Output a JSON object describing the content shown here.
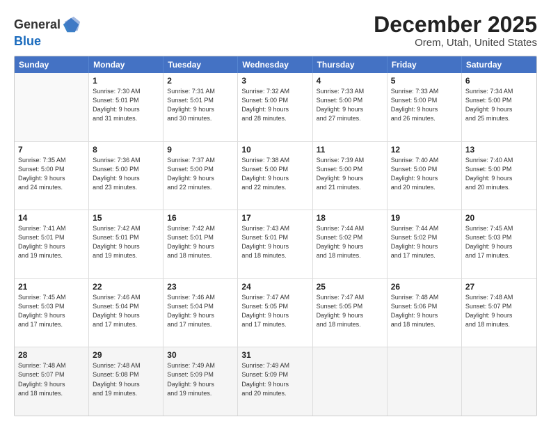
{
  "logo": {
    "line1": "General",
    "line2": "Blue"
  },
  "title": "December 2025",
  "subtitle": "Orem, Utah, United States",
  "days_header": [
    "Sunday",
    "Monday",
    "Tuesday",
    "Wednesday",
    "Thursday",
    "Friday",
    "Saturday"
  ],
  "weeks": [
    [
      {
        "day": "",
        "info": ""
      },
      {
        "day": "1",
        "info": "Sunrise: 7:30 AM\nSunset: 5:01 PM\nDaylight: 9 hours\nand 31 minutes."
      },
      {
        "day": "2",
        "info": "Sunrise: 7:31 AM\nSunset: 5:01 PM\nDaylight: 9 hours\nand 30 minutes."
      },
      {
        "day": "3",
        "info": "Sunrise: 7:32 AM\nSunset: 5:00 PM\nDaylight: 9 hours\nand 28 minutes."
      },
      {
        "day": "4",
        "info": "Sunrise: 7:33 AM\nSunset: 5:00 PM\nDaylight: 9 hours\nand 27 minutes."
      },
      {
        "day": "5",
        "info": "Sunrise: 7:33 AM\nSunset: 5:00 PM\nDaylight: 9 hours\nand 26 minutes."
      },
      {
        "day": "6",
        "info": "Sunrise: 7:34 AM\nSunset: 5:00 PM\nDaylight: 9 hours\nand 25 minutes."
      }
    ],
    [
      {
        "day": "7",
        "info": "Sunrise: 7:35 AM\nSunset: 5:00 PM\nDaylight: 9 hours\nand 24 minutes."
      },
      {
        "day": "8",
        "info": "Sunrise: 7:36 AM\nSunset: 5:00 PM\nDaylight: 9 hours\nand 23 minutes."
      },
      {
        "day": "9",
        "info": "Sunrise: 7:37 AM\nSunset: 5:00 PM\nDaylight: 9 hours\nand 22 minutes."
      },
      {
        "day": "10",
        "info": "Sunrise: 7:38 AM\nSunset: 5:00 PM\nDaylight: 9 hours\nand 22 minutes."
      },
      {
        "day": "11",
        "info": "Sunrise: 7:39 AM\nSunset: 5:00 PM\nDaylight: 9 hours\nand 21 minutes."
      },
      {
        "day": "12",
        "info": "Sunrise: 7:40 AM\nSunset: 5:00 PM\nDaylight: 9 hours\nand 20 minutes."
      },
      {
        "day": "13",
        "info": "Sunrise: 7:40 AM\nSunset: 5:00 PM\nDaylight: 9 hours\nand 20 minutes."
      }
    ],
    [
      {
        "day": "14",
        "info": "Sunrise: 7:41 AM\nSunset: 5:01 PM\nDaylight: 9 hours\nand 19 minutes."
      },
      {
        "day": "15",
        "info": "Sunrise: 7:42 AM\nSunset: 5:01 PM\nDaylight: 9 hours\nand 19 minutes."
      },
      {
        "day": "16",
        "info": "Sunrise: 7:42 AM\nSunset: 5:01 PM\nDaylight: 9 hours\nand 18 minutes."
      },
      {
        "day": "17",
        "info": "Sunrise: 7:43 AM\nSunset: 5:01 PM\nDaylight: 9 hours\nand 18 minutes."
      },
      {
        "day": "18",
        "info": "Sunrise: 7:44 AM\nSunset: 5:02 PM\nDaylight: 9 hours\nand 18 minutes."
      },
      {
        "day": "19",
        "info": "Sunrise: 7:44 AM\nSunset: 5:02 PM\nDaylight: 9 hours\nand 17 minutes."
      },
      {
        "day": "20",
        "info": "Sunrise: 7:45 AM\nSunset: 5:03 PM\nDaylight: 9 hours\nand 17 minutes."
      }
    ],
    [
      {
        "day": "21",
        "info": "Sunrise: 7:45 AM\nSunset: 5:03 PM\nDaylight: 9 hours\nand 17 minutes."
      },
      {
        "day": "22",
        "info": "Sunrise: 7:46 AM\nSunset: 5:04 PM\nDaylight: 9 hours\nand 17 minutes."
      },
      {
        "day": "23",
        "info": "Sunrise: 7:46 AM\nSunset: 5:04 PM\nDaylight: 9 hours\nand 17 minutes."
      },
      {
        "day": "24",
        "info": "Sunrise: 7:47 AM\nSunset: 5:05 PM\nDaylight: 9 hours\nand 17 minutes."
      },
      {
        "day": "25",
        "info": "Sunrise: 7:47 AM\nSunset: 5:05 PM\nDaylight: 9 hours\nand 18 minutes."
      },
      {
        "day": "26",
        "info": "Sunrise: 7:48 AM\nSunset: 5:06 PM\nDaylight: 9 hours\nand 18 minutes."
      },
      {
        "day": "27",
        "info": "Sunrise: 7:48 AM\nSunset: 5:07 PM\nDaylight: 9 hours\nand 18 minutes."
      }
    ],
    [
      {
        "day": "28",
        "info": "Sunrise: 7:48 AM\nSunset: 5:07 PM\nDaylight: 9 hours\nand 18 minutes."
      },
      {
        "day": "29",
        "info": "Sunrise: 7:48 AM\nSunset: 5:08 PM\nDaylight: 9 hours\nand 19 minutes."
      },
      {
        "day": "30",
        "info": "Sunrise: 7:49 AM\nSunset: 5:09 PM\nDaylight: 9 hours\nand 19 minutes."
      },
      {
        "day": "31",
        "info": "Sunrise: 7:49 AM\nSunset: 5:09 PM\nDaylight: 9 hours\nand 20 minutes."
      },
      {
        "day": "",
        "info": ""
      },
      {
        "day": "",
        "info": ""
      },
      {
        "day": "",
        "info": ""
      }
    ]
  ]
}
